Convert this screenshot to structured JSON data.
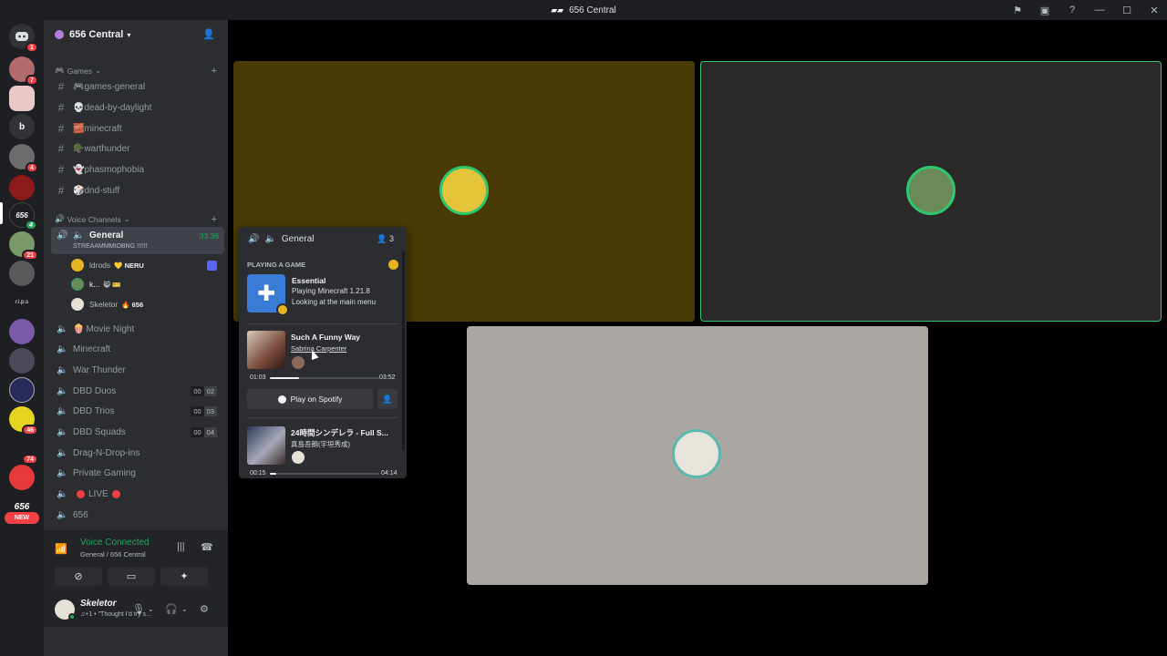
{
  "window": {
    "title": "656 Central"
  },
  "server": {
    "name": "656 Central"
  },
  "rail": {
    "badges": [
      "1",
      "7",
      "4",
      "4",
      "21",
      "46",
      "74"
    ],
    "labels": [
      "b",
      "r.i.p.s",
      "656"
    ],
    "new_label": "NEW"
  },
  "categories": {
    "games": "Games",
    "voice": "Voice Channels"
  },
  "text_channels": [
    {
      "label": "🎮games-general"
    },
    {
      "label": "💀dead-by-daylight"
    },
    {
      "label": "🧱minecraft"
    },
    {
      "label": "🪖warthunder"
    },
    {
      "label": "👻phasmophobia"
    },
    {
      "label": "🎲dnd-stuff"
    }
  ],
  "voice_active": {
    "name": "General",
    "timer": "33:36",
    "status": "STREAAMMMIOBNG !!!!!!"
  },
  "voice_users": [
    {
      "name": "ldrods",
      "tag": "💛 NERU"
    },
    {
      "name": "k...",
      "tag": "😸 🎫"
    },
    {
      "name": "Skeletor",
      "tag": "🔥 656"
    }
  ],
  "voice_channels": [
    {
      "label": "Movie Night",
      "prefix": "🍿"
    },
    {
      "label": "Minecraft"
    },
    {
      "label": "War Thunder"
    },
    {
      "label": "DBD Duos",
      "used": "00",
      "limit": "02"
    },
    {
      "label": "DBD Trios",
      "used": "00",
      "limit": "03"
    },
    {
      "label": "DBD Squads",
      "used": "00",
      "limit": "04"
    },
    {
      "label": "Drag-N-Drop-ins"
    },
    {
      "label": "Private Gaming"
    },
    {
      "label": "LIVE"
    },
    {
      "label": "656"
    }
  ],
  "voice_panel": {
    "status": "Voice Connected",
    "location": "General / 656 Central"
  },
  "user": {
    "name": "Skeletor",
    "status": "♫+1 • \"Thought I'd try s..."
  },
  "popout": {
    "channel": "General",
    "count": "3",
    "section": "PLAYING A GAME",
    "game": {
      "title": "Essential",
      "line1": "Playing Minecraft 1.21.8",
      "line2": "Looking at the main menu"
    },
    "song1": {
      "title": "Such A Funny Way",
      "artist": "Sabrina Carpenter",
      "elapsed": "01:03",
      "total": "03:52",
      "progress": 0.27
    },
    "spotify_label": "Play on Spotify",
    "song2": {
      "title": "24時間シンデレラ - Full S...",
      "artist": "真島吾朗(宇垣秀成)",
      "elapsed": "00:15",
      "total": "04:14",
      "progress": 0.06
    }
  },
  "colors": {
    "accent_green": "#23a55a",
    "live_red": "#f23f43",
    "blurple": "#5865f2"
  }
}
